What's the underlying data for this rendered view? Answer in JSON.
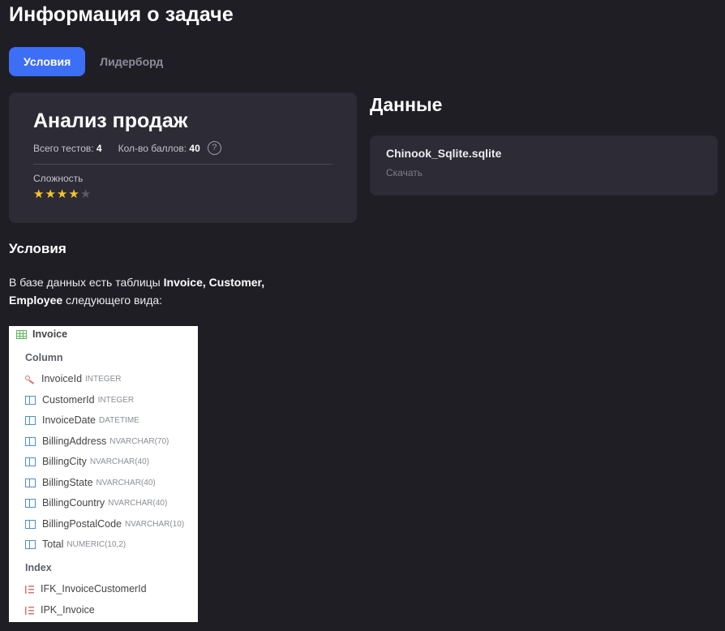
{
  "page_title": "Информация о задаче",
  "tabs": [
    {
      "label": "Условия",
      "active": true
    },
    {
      "label": "Лидерборд",
      "active": false
    }
  ],
  "task": {
    "title": "Анализ продаж",
    "tests_label": "Всего тестов:",
    "tests_value": "4",
    "points_label": "Кол-во баллов:",
    "points_value": "40",
    "help_icon_text": "?",
    "difficulty_label": "Сложность",
    "difficulty_rating": 4,
    "difficulty_max": 5
  },
  "data_section": {
    "title": "Данные",
    "file_name": "Chinook_Sqlite.sqlite",
    "download_label": "Скачать"
  },
  "conditions": {
    "heading": "Условия",
    "text_before": "В базе данных есть таблицы ",
    "tables_bold_1": "Invoice, Customer,",
    "tables_bold_2": "Employee",
    "text_after": " следующего вида:"
  },
  "schema": {
    "table_name": "Invoice",
    "column_section": "Column",
    "columns": [
      {
        "name": "InvoiceId",
        "type": "INTEGER",
        "icon": "key-icon"
      },
      {
        "name": "CustomerId",
        "type": "INTEGER",
        "icon": "column-icon"
      },
      {
        "name": "InvoiceDate",
        "type": "DATETIME",
        "icon": "column-icon"
      },
      {
        "name": "BillingAddress",
        "type": "NVARCHAR(70)",
        "icon": "column-icon"
      },
      {
        "name": "BillingCity",
        "type": "NVARCHAR(40)",
        "icon": "column-icon"
      },
      {
        "name": "BillingState",
        "type": "NVARCHAR(40)",
        "icon": "column-icon"
      },
      {
        "name": "BillingCountry",
        "type": "NVARCHAR(40)",
        "icon": "column-icon"
      },
      {
        "name": "BillingPostalCode",
        "type": "NVARCHAR(10)",
        "icon": "column-icon"
      },
      {
        "name": "Total",
        "type": "NUMERIC(10,2)",
        "icon": "column-icon"
      }
    ],
    "index_section": "Index",
    "indexes": [
      {
        "name": "IFK_InvoiceCustomerId",
        "icon": "index-icon"
      },
      {
        "name": "IPK_Invoice",
        "icon": "index-icon"
      }
    ]
  },
  "colors": {
    "background": "#1f1e25",
    "card": "#2c2b36",
    "accent": "#3d6ef6",
    "star_filled": "#f4c430",
    "star_empty": "#5a5966"
  }
}
